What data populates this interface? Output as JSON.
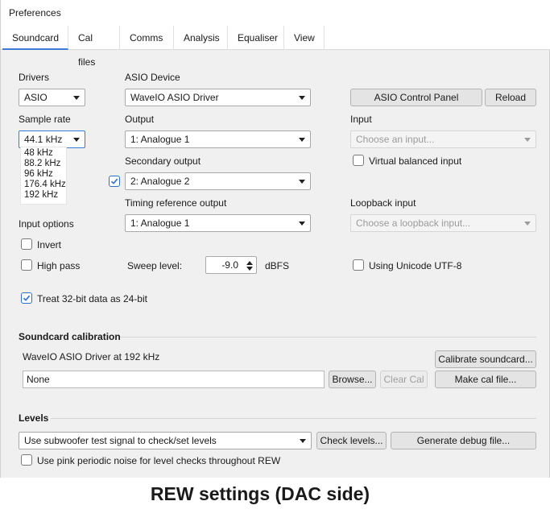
{
  "window": {
    "title": "Preferences"
  },
  "tabs": [
    {
      "label": "Soundcard"
    },
    {
      "label": "Cal files"
    },
    {
      "label": "Comms"
    },
    {
      "label": "Analysis"
    },
    {
      "label": "Equaliser"
    },
    {
      "label": "View"
    }
  ],
  "drivers": {
    "label": "Drivers",
    "value": "ASIO"
  },
  "asio_device": {
    "label": "ASIO Device",
    "value": "WaveIO ASIO Driver"
  },
  "buttons": {
    "asio_control_panel": "ASIO Control Panel",
    "reload": "Reload",
    "calibrate_soundcard": "Calibrate soundcard...",
    "browse": "Browse...",
    "clear_cal": "Clear Cal",
    "make_cal_file": "Make cal file...",
    "check_levels": "Check levels...",
    "generate_debug_file": "Generate debug file..."
  },
  "sample_rate": {
    "label": "Sample rate",
    "value": "44.1 kHz",
    "options": [
      "48 kHz",
      "88.2 kHz",
      "96 kHz",
      "176.4 kHz",
      "192 kHz"
    ]
  },
  "output": {
    "label": "Output",
    "value": "1: Analogue 1"
  },
  "input": {
    "label": "Input",
    "placeholder": "Choose an input..."
  },
  "secondary_output": {
    "label": "Secondary output",
    "value": "2: Analogue 2",
    "enabled": true
  },
  "virtual_balanced_input": {
    "label": "Virtual balanced input",
    "checked": false
  },
  "timing_reference_output": {
    "label": "Timing reference output",
    "value": "1: Analogue 1"
  },
  "loopback_input": {
    "label": "Loopback input",
    "placeholder": "Choose a loopback input..."
  },
  "input_options": {
    "label": "Input options",
    "invert": {
      "label": "Invert",
      "checked": false
    },
    "high_pass": {
      "label": "High pass",
      "checked": false
    }
  },
  "sweep_level": {
    "label": "Sweep level:",
    "value": "-9.0",
    "unit": "dBFS"
  },
  "unicode": {
    "label": "Using Unicode UTF-8",
    "checked": false
  },
  "treat_32bit": {
    "label": "Treat 32-bit data as 24-bit",
    "checked": true
  },
  "soundcard_calibration": {
    "title": "Soundcard calibration",
    "driver_info": "WaveIO ASIO Driver at 192 kHz",
    "cal_file": "None"
  },
  "levels": {
    "title": "Levels",
    "method": "Use subwoofer test signal to check/set levels",
    "pink_noise": {
      "label": "Use pink periodic noise for level checks throughout REW",
      "checked": false
    }
  },
  "caption": "REW settings (DAC side)",
  "colors": {
    "accent": "#3a7bd5",
    "window_bg": "#f0f0f0"
  }
}
